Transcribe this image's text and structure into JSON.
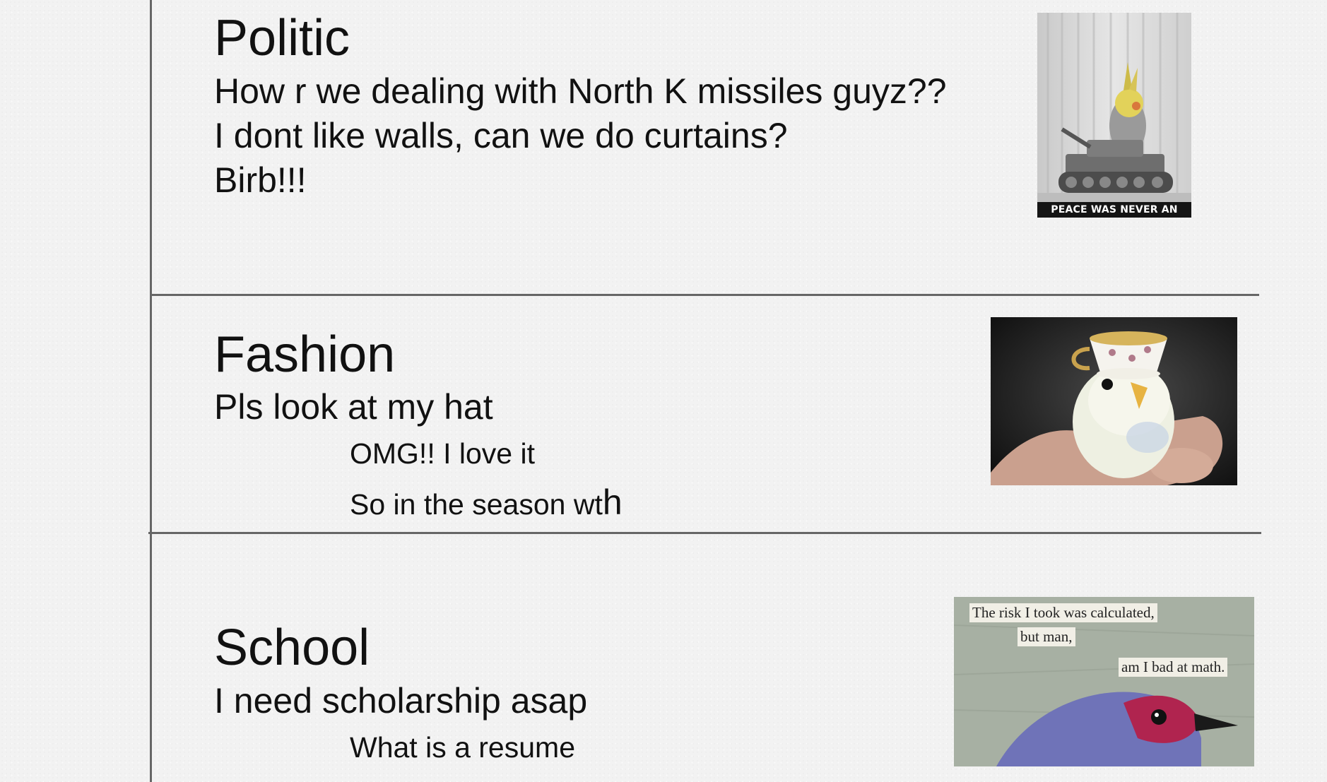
{
  "sections": [
    {
      "title": "Politic",
      "posts": [
        "How r we dealing with North K missiles guyz??",
        "I dont like walls, can we do curtains?",
        "Birb!!!"
      ],
      "image": {
        "icon": "cockatiel-tank-image",
        "caption": "PEACE WAS NEVER AN OPTION"
      }
    },
    {
      "title": "Fashion",
      "posts": [
        "Pls look at my hat"
      ],
      "replies": [
        "OMG!! I love it",
        "So in the season wt",
        "h"
      ],
      "image": {
        "icon": "budgie-teacup-hat-image"
      }
    },
    {
      "title": "School",
      "posts": [
        "I need scholarship asap"
      ],
      "replies": [
        "What is a resume"
      ],
      "image": {
        "icon": "painted-bird-meme-image",
        "lines": [
          "The risk I took was calculated,",
          "but man,",
          "am I bad at math."
        ]
      }
    }
  ],
  "colors": {
    "background": "#f2f2f2",
    "rule": "#666666",
    "text": "#111111"
  }
}
